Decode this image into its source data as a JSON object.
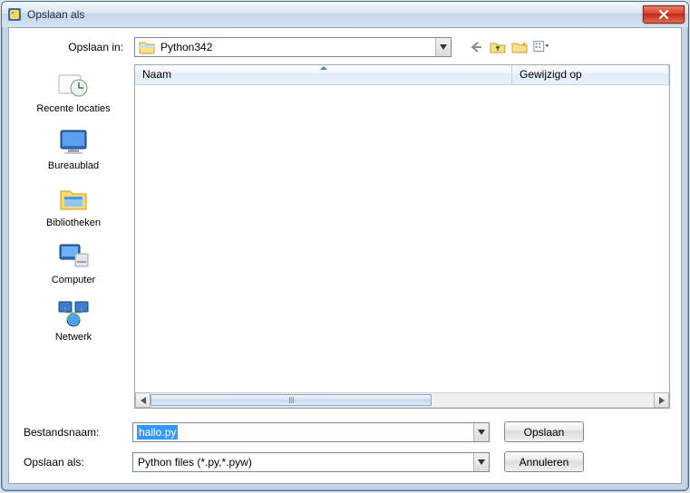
{
  "window": {
    "title": "Opslaan als",
    "close_glyph": "X"
  },
  "location": {
    "label": "Opslaan in:",
    "value": "Python342"
  },
  "nav": {
    "back": "back-icon",
    "up": "folder-up-icon",
    "new": "new-folder-icon",
    "view": "view-menu-icon"
  },
  "places": [
    {
      "label": "Recente locaties"
    },
    {
      "label": "Bureaublad"
    },
    {
      "label": "Bibliotheken"
    },
    {
      "label": "Computer"
    },
    {
      "label": "Netwerk"
    }
  ],
  "columns": {
    "name": "Naam",
    "modified": "Gewijzigd op"
  },
  "filename_label": "Bestandsnaam:",
  "filename_value": "hallo.py",
  "filetype_label": "Opslaan als:",
  "filetype_value": "Python files (*.py,*.pyw)",
  "buttons": {
    "save": "Opslaan",
    "cancel": "Annuleren"
  }
}
